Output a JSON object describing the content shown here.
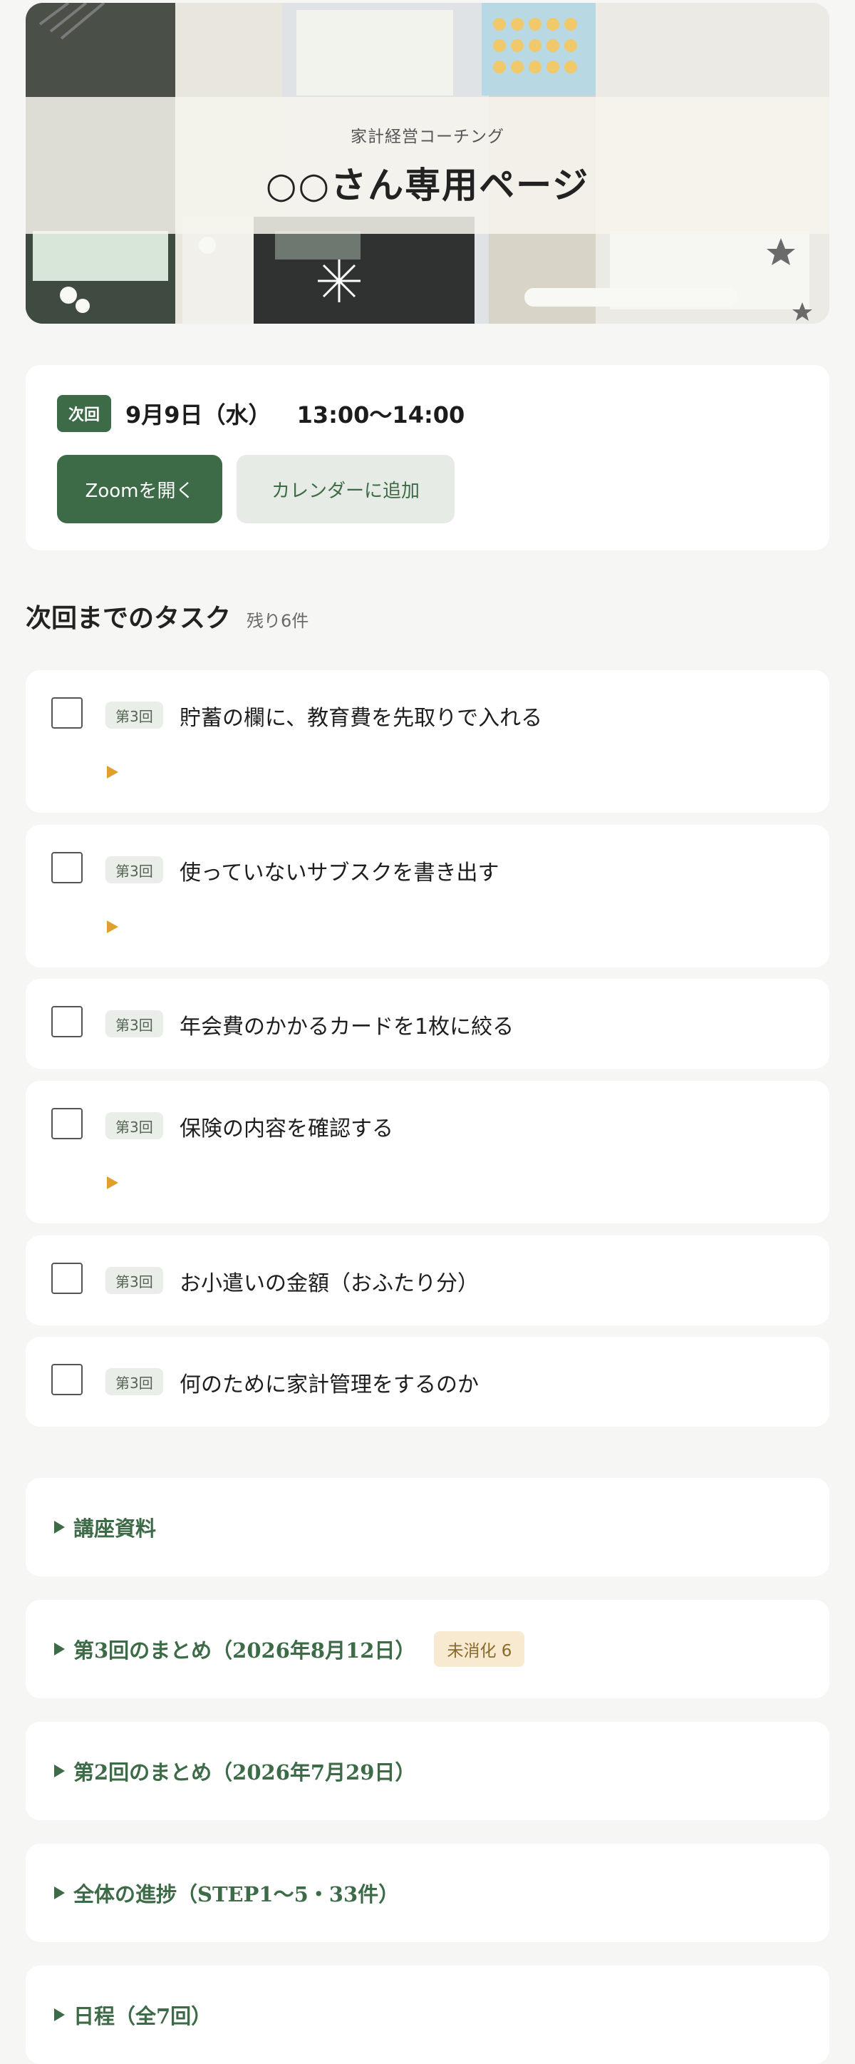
{
  "hero": {
    "subtitle": "家計経営コーチング",
    "title": "○○さん専用ページ"
  },
  "next": {
    "badge": "次回",
    "date": "9月9日（水）",
    "time": "13:00〜14:00",
    "zoom_label": "Zoomを開く",
    "calendar_label": "カレンダーに追加"
  },
  "tasks": {
    "title": "次回までのタスク",
    "remaining": "残り6件",
    "items": [
      {
        "tag": "第3回",
        "text": "貯蓄の欄に、教育費を先取りで入れる",
        "expandable": true
      },
      {
        "tag": "第3回",
        "text": "使っていないサブスクを書き出す",
        "expandable": true
      },
      {
        "tag": "第3回",
        "text": "年会費のかかるカードを1枚に絞る",
        "expandable": false
      },
      {
        "tag": "第3回",
        "text": "保険の内容を確認する",
        "expandable": true
      },
      {
        "tag": "第3回",
        "text": "お小遣いの金額（おふたり分）",
        "expandable": false
      },
      {
        "tag": "第3回",
        "text": "何のために家計管理をするのか",
        "expandable": false
      }
    ]
  },
  "sections": [
    {
      "label": "講座資料"
    },
    {
      "label": "第3回のまとめ（2026年8月12日）",
      "badge": "未消化 6"
    },
    {
      "label": "第2回のまとめ（2026年7月29日）"
    },
    {
      "label": "全体の進捗（STEP1〜5・33件）"
    },
    {
      "label": "日程（全7回）"
    }
  ],
  "colors": {
    "accent": "#3d6b47",
    "expand_marker": "#e0a030",
    "badge_bg": "#f7ead0"
  }
}
